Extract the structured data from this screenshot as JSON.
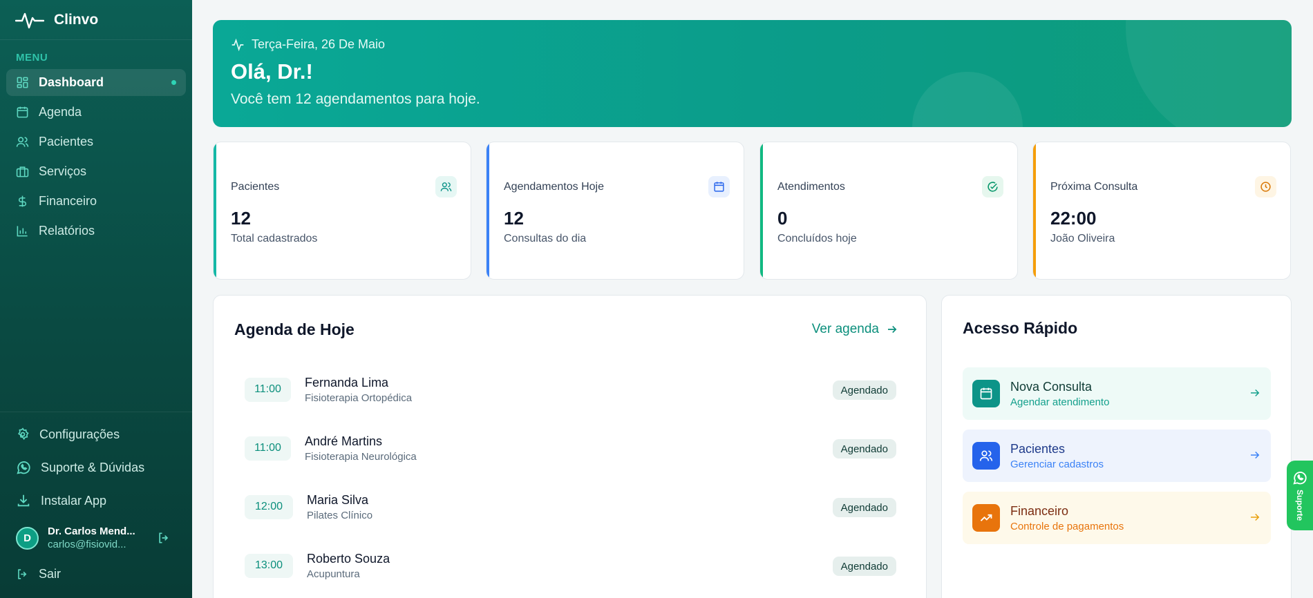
{
  "brand": {
    "name": "Clinvo"
  },
  "sidebar": {
    "menu_label": "MENU",
    "items": [
      {
        "label": "Dashboard",
        "icon": "dashboard-icon",
        "active": true
      },
      {
        "label": "Agenda",
        "icon": "calendar-icon"
      },
      {
        "label": "Pacientes",
        "icon": "users-icon"
      },
      {
        "label": "Serviços",
        "icon": "briefcase-icon"
      },
      {
        "label": "Financeiro",
        "icon": "dollar-icon"
      },
      {
        "label": "Relatórios",
        "icon": "bar-chart-icon"
      }
    ],
    "bottom": {
      "settings": "Configurações",
      "support": "Suporte & Dúvidas",
      "install": "Instalar App",
      "logout": "Sair"
    },
    "user": {
      "initial": "D",
      "name": "Dr. Carlos Mend...",
      "email": "carlos@fisiovid..."
    }
  },
  "hero": {
    "date": "Terça-Feira, 26 De Maio",
    "greeting": "Olá, Dr.!",
    "subtitle": "Você tem 12 agendamentos para hoje."
  },
  "stats": [
    {
      "label": "Pacientes",
      "value": "12",
      "sub": "Total cadastrados",
      "color": "#14b8a6",
      "icon": "users-icon"
    },
    {
      "label": "Agendamentos Hoje",
      "value": "12",
      "sub": "Consultas do dia",
      "color": "#3b82f6",
      "icon": "calendar-icon"
    },
    {
      "label": "Atendimentos",
      "value": "0",
      "sub": "Concluídos hoje",
      "color": "#10b981",
      "icon": "check-circle-icon"
    },
    {
      "label": "Próxima Consulta",
      "value": "22:00",
      "sub": "João Oliveira",
      "color": "#f59e0b",
      "icon": "clock-icon"
    }
  ],
  "agenda": {
    "title": "Agenda de Hoje",
    "link": "Ver agenda",
    "appointments": [
      {
        "time": "11:00",
        "name": "Fernanda Lima",
        "service": "Fisioterapia Ortopédica",
        "status": "Agendado"
      },
      {
        "time": "11:00",
        "name": "André Martins",
        "service": "Fisioterapia Neurológica",
        "status": "Agendado"
      },
      {
        "time": "12:00",
        "name": "Maria Silva",
        "service": "Pilates Clínico",
        "status": "Agendado"
      },
      {
        "time": "13:00",
        "name": "Roberto Souza",
        "service": "Acupuntura",
        "status": "Agendado"
      }
    ]
  },
  "quick": {
    "title": "Acesso Rápido",
    "items": [
      {
        "title": "Nova Consulta",
        "sub": "Agendar atendimento",
        "icon": "calendar-icon"
      },
      {
        "title": "Pacientes",
        "sub": "Gerenciar cadastros",
        "icon": "users-icon"
      },
      {
        "title": "Financeiro",
        "sub": "Controle de pagamentos",
        "icon": "trending-up-icon"
      }
    ]
  },
  "whatsapp": {
    "label": "Suporte"
  }
}
